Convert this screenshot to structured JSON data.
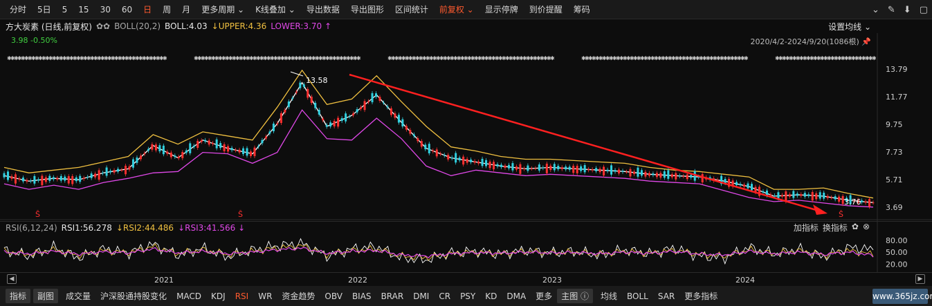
{
  "toolbar": {
    "items": [
      "分时",
      "5日",
      "5",
      "15",
      "30",
      "60",
      "日",
      "周",
      "月",
      "更多周期 ⌄",
      "K线叠加 ⌄",
      "导出数据",
      "导出图形",
      "区间统计",
      "前复权 ⌄",
      "显示停牌",
      "到价提醒",
      "筹码"
    ],
    "active_index": 6,
    "active_index2": 14,
    "right_icons": [
      "chevron-circle-icon",
      "brush-icon",
      "arrow-down-icon",
      "window-icon"
    ]
  },
  "main_header": {
    "title": "方大炭素 (日线,前复权)",
    "gear": "✿✿",
    "boll_name": "BOLL(20,2)",
    "boll": "BOLL:4.03",
    "upper": "↓UPPER:4.36",
    "lower": "LOWER:3.70 ↑"
  },
  "setup_avg": "设置均线 ⌄",
  "range_text": "2020/4/2-2024/9/20(1086根) 📌",
  "price_change": "3.98  -0.50%",
  "annotations": {
    "high": "13.58",
    "low": "3.76"
  },
  "markers": {
    "s": "Ŝ"
  },
  "rsi_header": {
    "name": "RSI(6,12,24)",
    "rsi1": "RSI1:56.278",
    "rsi2": "↓RSI2:44.486",
    "rsi3": "↓RSI3:41.566 ↓"
  },
  "rsi_tools": {
    "add": "加指标",
    "switch": "换指标"
  },
  "chart_data": [
    {
      "type": "line",
      "title": "方大炭素 (日线,前复权)",
      "y_ticks": [
        "13.79",
        "11.77",
        "9.75",
        "7.73",
        "5.71",
        "3.69"
      ],
      "ylim": [
        3.69,
        13.79
      ],
      "x_labels": [
        "2021",
        "2022",
        "2023",
        "2024"
      ],
      "series": [
        {
          "name": "BOLL",
          "color": "#ffffff",
          "values": [
            6.0,
            5.6,
            5.8,
            5.7,
            6.2,
            6.5,
            8.2,
            7.3,
            8.6,
            8.0,
            7.6,
            9.8,
            12.8,
            9.6,
            10.4,
            11.9,
            9.9,
            8.0,
            7.3,
            7.0,
            6.7,
            6.5,
            6.6,
            6.5,
            6.4,
            6.3,
            6.1,
            6.0,
            5.9,
            5.6,
            5.2,
            4.5,
            4.6,
            4.5,
            4.2,
            4.03
          ]
        },
        {
          "name": "UPPER",
          "color": "#f0c040",
          "values": [
            6.6,
            6.2,
            6.4,
            6.6,
            7.0,
            7.4,
            9.0,
            8.3,
            9.2,
            8.9,
            8.6,
            11.0,
            13.7,
            11.2,
            11.6,
            13.3,
            11.4,
            9.6,
            8.1,
            7.8,
            7.4,
            7.2,
            7.2,
            7.1,
            7.0,
            6.9,
            6.6,
            6.4,
            6.3,
            6.1,
            5.9,
            5.0,
            5.0,
            5.1,
            4.7,
            4.36
          ]
        },
        {
          "name": "LOWER",
          "color": "#e048e8",
          "values": [
            5.4,
            5.0,
            5.3,
            5.0,
            5.5,
            5.8,
            6.2,
            6.3,
            7.7,
            7.6,
            6.9,
            7.7,
            10.8,
            8.7,
            8.6,
            10.2,
            8.7,
            6.7,
            6.0,
            6.4,
            6.2,
            6.0,
            6.1,
            6.0,
            5.9,
            5.8,
            5.6,
            5.5,
            5.4,
            4.9,
            4.4,
            4.1,
            4.2,
            4.0,
            3.8,
            3.7
          ]
        }
      ]
    },
    {
      "type": "line",
      "title": "RSI(6,12,24)",
      "y_ticks": [
        "80.00",
        "50.00",
        "20.00"
      ],
      "ylim": [
        10,
        90
      ],
      "series": [
        {
          "name": "RSI1",
          "color": "#ffffff",
          "values": [
            55,
            40,
            62,
            35,
            58,
            48,
            70,
            42,
            60,
            38,
            55,
            66,
            72,
            40,
            58,
            64,
            35,
            30,
            48,
            52,
            45,
            55,
            48,
            52,
            42,
            56,
            46,
            60,
            40,
            35,
            62,
            45,
            58,
            38,
            62,
            56.278
          ]
        },
        {
          "name": "RSI2",
          "color": "#f0c040",
          "values": [
            52,
            44,
            56,
            42,
            54,
            48,
            64,
            46,
            56,
            44,
            52,
            60,
            66,
            44,
            54,
            58,
            40,
            36,
            46,
            50,
            46,
            52,
            48,
            50,
            45,
            52,
            47,
            55,
            44,
            40,
            56,
            46,
            54,
            42,
            54,
            44.486
          ]
        },
        {
          "name": "RSI3",
          "color": "#e048e8",
          "values": [
            50,
            46,
            52,
            45,
            51,
            48,
            58,
            48,
            52,
            46,
            50,
            56,
            60,
            47,
            52,
            54,
            43,
            40,
            46,
            49,
            47,
            50,
            48,
            49,
            46,
            50,
            47,
            52,
            45,
            43,
            52,
            46,
            50,
            44,
            50,
            41.566
          ]
        }
      ]
    }
  ],
  "year_axis": [
    "2021",
    "2022",
    "2023",
    "2024"
  ],
  "bottom_bar": {
    "items": [
      "指标",
      "副图",
      "成交量",
      "沪深股通持股变化",
      "MACD",
      "KDJ",
      "RSI",
      "WR",
      "资金趋势",
      "OBV",
      "BIAS",
      "BRAR",
      "DMI",
      "CR",
      "PSY",
      "KD",
      "DMA",
      "更多",
      "主图 ⓘ",
      "均线",
      "BOLL",
      "SAR",
      "更多指标"
    ],
    "active_index": 6,
    "boxed": [
      0,
      1,
      18
    ]
  },
  "watermark": "www.365jz.com"
}
